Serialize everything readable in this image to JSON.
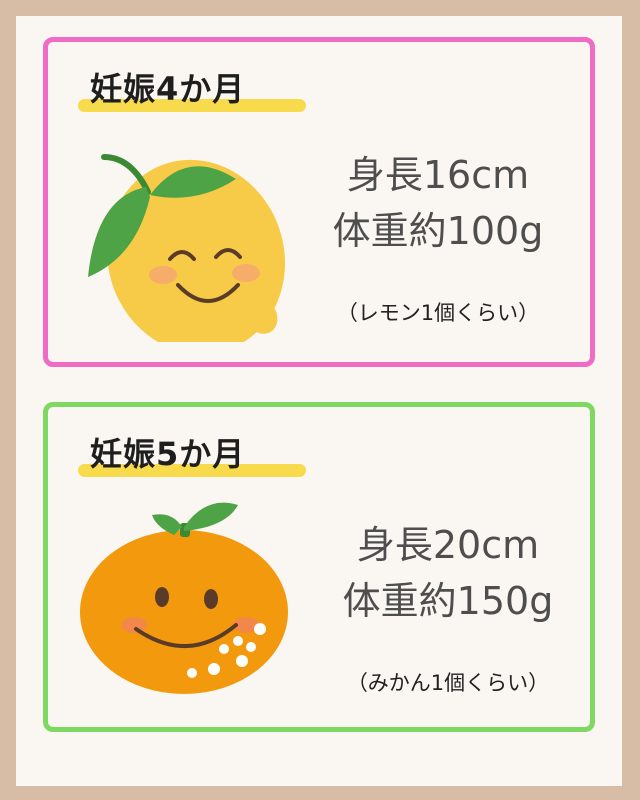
{
  "cards": [
    {
      "title": "妊娠4か月",
      "height_text": "身長16cm",
      "weight_text": "体重約100g",
      "note": "（レモン1個くらい）",
      "fruit_icon": "lemon-icon",
      "border_color": "#f06bc3"
    },
    {
      "title": "妊娠5か月",
      "height_text": "身長20cm",
      "weight_text": "体重約150g",
      "note": "（みかん1個くらい）",
      "fruit_icon": "mikan-icon",
      "border_color": "#7ed861"
    }
  ],
  "colors": {
    "background": "#d8bda6",
    "panel": "#faf6f1",
    "highlight": "#f8db4c",
    "lemon": "#f7cb47",
    "mikan": "#f3990d",
    "leaf": "#4ea346"
  }
}
